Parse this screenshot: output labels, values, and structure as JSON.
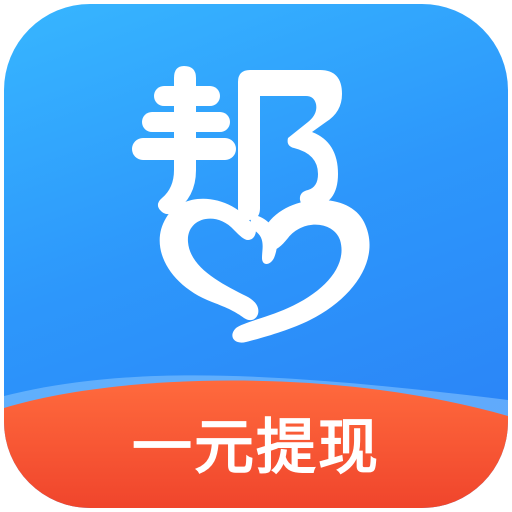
{
  "app_icon": {
    "name": "帮",
    "banner_text": "一元提现",
    "glyph_icon": "bang-heart-logo-icon"
  },
  "colors": {
    "background_top": "#37b6ff",
    "background_bottom": "#2a7ff6",
    "banner_top": "#ff6a3d",
    "banner_bottom": "#f0452c",
    "glyph": "#ffffff"
  }
}
